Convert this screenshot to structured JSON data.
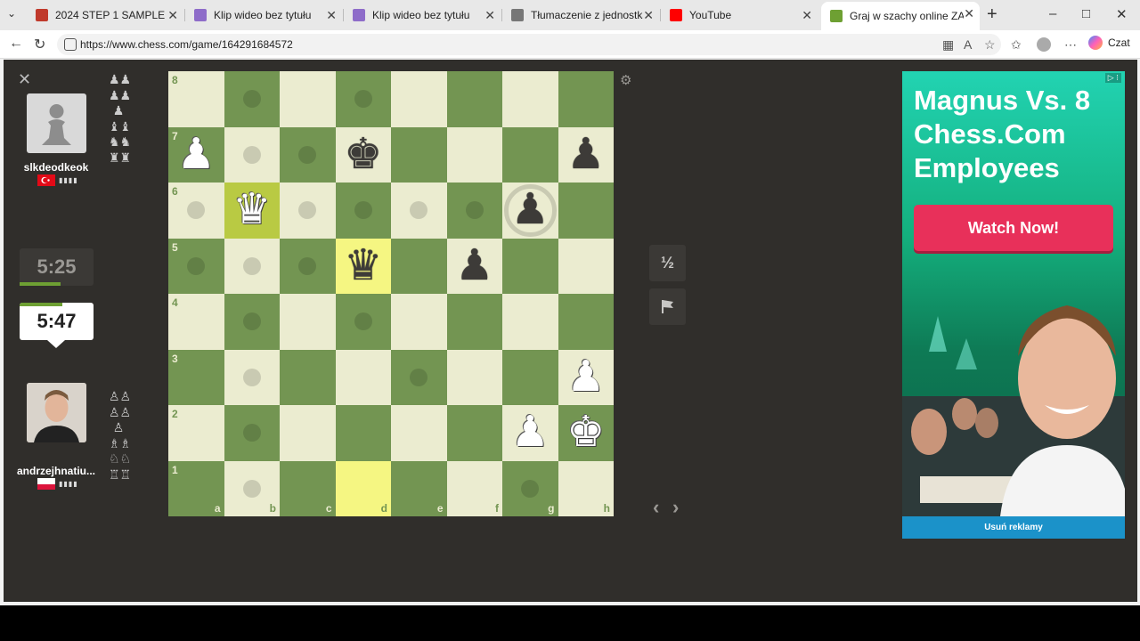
{
  "browser": {
    "tabs": [
      {
        "label": "2024 STEP 1 SAMPLE ITEMS",
        "icon": "pdf-icon",
        "color": "#c0392b"
      },
      {
        "label": "Klip wideo bez tytułu",
        "icon": "video-icon",
        "color": "#8e6cc9"
      },
      {
        "label": "Klip wideo bez tytułu",
        "icon": "video-icon",
        "color": "#8e6cc9"
      },
      {
        "label": "Tłumaczenie z jednostkami EU",
        "icon": "translate-icon",
        "color": "#777777"
      },
      {
        "label": "YouTube",
        "icon": "youtube-icon",
        "color": "#ff0000"
      },
      {
        "label": "Graj w szachy online ZA DARMO",
        "icon": "chess-pawn-icon",
        "color": "#6ea033"
      }
    ],
    "url": "https://www.chess.com/game/164291684572",
    "copilot_label": "Czat"
  },
  "players": {
    "top": {
      "name": "slkdeodkeok",
      "flag": "Turkey",
      "clock": "5:25",
      "clock_progress": 0.55
    },
    "bottom": {
      "name": "andrzejhnatiu...",
      "flag": "Poland",
      "clock": "5:47",
      "clock_progress": 0.58
    }
  },
  "captured": {
    "top": [
      "♟♟",
      "♟♟",
      "♟",
      "♝♝",
      "♞♞",
      "♜♜"
    ],
    "bottom": [
      "♙♙",
      "♙♙",
      "♙",
      "♗♗",
      "♘♘",
      "♖♖"
    ]
  },
  "board": {
    "ranks": [
      "8",
      "7",
      "6",
      "5",
      "4",
      "3",
      "2",
      "1"
    ],
    "files": [
      "a",
      "b",
      "c",
      "d",
      "e",
      "f",
      "g",
      "h"
    ],
    "pieces": [
      {
        "sq": "a7",
        "glyph": "♟",
        "color": "white"
      },
      {
        "sq": "d7",
        "glyph": "♚",
        "color": "black"
      },
      {
        "sq": "h7",
        "glyph": "♟",
        "color": "black"
      },
      {
        "sq": "b6",
        "glyph": "♛",
        "color": "white"
      },
      {
        "sq": "g6",
        "glyph": "♟",
        "color": "black"
      },
      {
        "sq": "d5",
        "glyph": "♛",
        "color": "black"
      },
      {
        "sq": "f5",
        "glyph": "♟",
        "color": "black"
      },
      {
        "sq": "h3",
        "glyph": "♟",
        "color": "white"
      },
      {
        "sq": "g2",
        "glyph": "♟",
        "color": "white"
      },
      {
        "sq": "h2",
        "glyph": "♚",
        "color": "white"
      }
    ],
    "highlights": [
      "b6",
      "d5",
      "d1"
    ],
    "move_dots": [
      "b8",
      "d8",
      "b7",
      "c7",
      "a6",
      "c6",
      "d6",
      "e6",
      "f6",
      "a5",
      "b5",
      "c5",
      "b4",
      "d4",
      "b3",
      "e3",
      "b2",
      "b1",
      "g1"
    ],
    "capture_rings": [
      "g6"
    ]
  },
  "controls": {
    "draw_label": "½",
    "resign_icon": "flag-icon"
  },
  "ad": {
    "headline": "Magnus Vs. 8 Chess.Com Employees",
    "cta": "Watch Now!",
    "footer": "Usuń reklamy",
    "badge": "▷ ⁝"
  }
}
